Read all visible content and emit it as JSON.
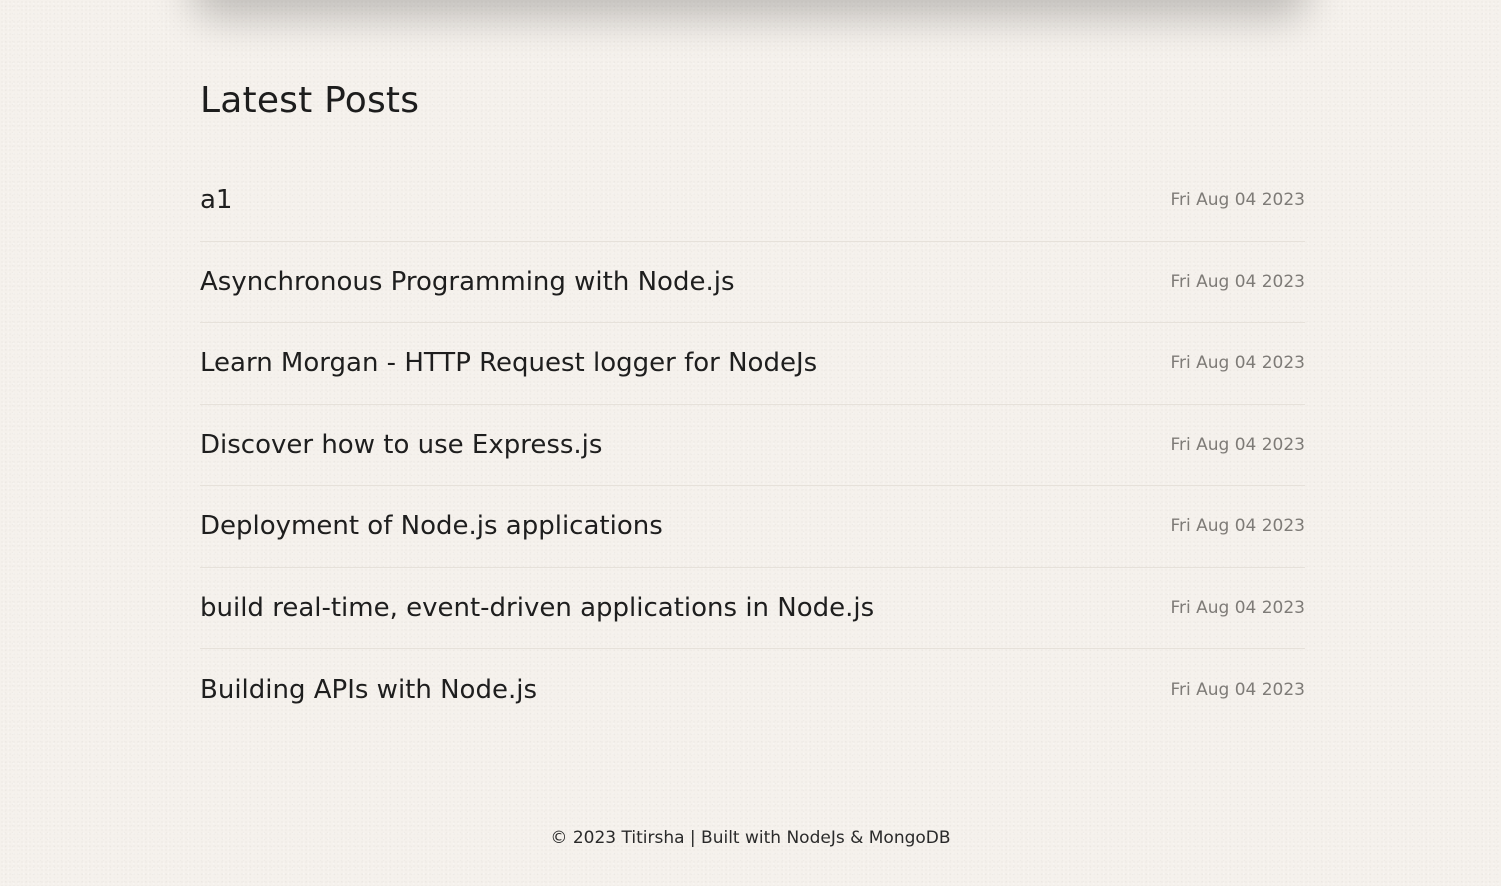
{
  "section": {
    "title": "Latest Posts"
  },
  "posts": [
    {
      "title": "a1",
      "date": "Fri Aug 04 2023"
    },
    {
      "title": "Asynchronous Programming with Node.js",
      "date": "Fri Aug 04 2023"
    },
    {
      "title": "Learn Morgan - HTTP Request logger for NodeJs",
      "date": "Fri Aug 04 2023"
    },
    {
      "title": "Discover how to use Express.js",
      "date": "Fri Aug 04 2023"
    },
    {
      "title": "Deployment of Node.js applications",
      "date": "Fri Aug 04 2023"
    },
    {
      "title": "build real-time, event-driven applications in Node.js",
      "date": "Fri Aug 04 2023"
    },
    {
      "title": "Building APIs with Node.js",
      "date": "Fri Aug 04 2023"
    }
  ],
  "footer": {
    "text": "© 2023 Titirsha | Built with NodeJs & MongoDB"
  },
  "colors": {
    "background": "#f5f1ec",
    "text": "#1e1e1e",
    "date": "#7e7b77",
    "divider": "#e6e1da"
  }
}
